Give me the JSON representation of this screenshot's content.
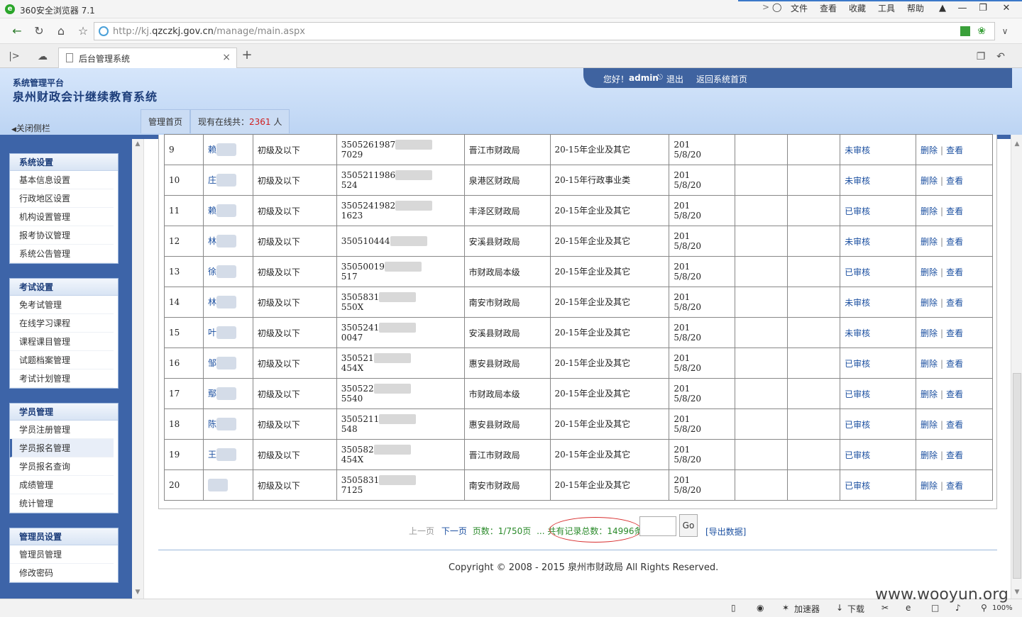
{
  "browser": {
    "title": "360安全浏览器 7.1",
    "menus": [
      "文件",
      "查看",
      "收藏",
      "工具",
      "帮助"
    ],
    "url_prefix": "http://kj.",
    "url_domain": "qzczkj.gov.cn",
    "url_path": "/manage/main.aspx",
    "tab_title": "后台管理系统",
    "tab_close": "×",
    "new_tab": "+"
  },
  "app": {
    "subtitle": "系统管理平台",
    "title": "泉州财政会计继续教育系统",
    "welcome": "您好！",
    "user": "admin",
    "logout": "退出",
    "home_return": "返回系统首页",
    "close_sidebar": "关闭侧栏",
    "tab_home": "管理首页",
    "online_prefix": "现有在线共：",
    "online_count": "2361",
    "online_suffix": "人"
  },
  "sidebar": [
    {
      "header": "系统设置",
      "items": [
        "基本信息设置",
        "行政地区设置",
        "机构设置管理",
        "报考协议管理",
        "系统公告管理"
      ]
    },
    {
      "header": "考试设置",
      "items": [
        "免考试管理",
        "在线学习课程",
        "课程课目管理",
        "试题档案管理",
        "考试计划管理"
      ]
    },
    {
      "header": "学员管理",
      "items": [
        "学员注册管理",
        "学员报名管理",
        "学员报名查询",
        "成绩管理",
        "统计管理"
      ]
    },
    {
      "header": "管理员设置",
      "items": [
        "管理员管理",
        "修改密码"
      ]
    }
  ],
  "table": {
    "rows": [
      {
        "no": "9",
        "name": "赖",
        "title": "初级及以下",
        "id1": "3505261987",
        "id2": "7029",
        "bureau": "晋江市财政局",
        "category": "20-15年企业及其它",
        "date1": "201",
        "date2": "5/8/20",
        "status": "未审核"
      },
      {
        "no": "10",
        "name": "庄",
        "title": "初级及以下",
        "id1": "3505211986",
        "id2": "524",
        "bureau": "泉港区财政局",
        "category": "20-15年行政事业类",
        "date1": "201",
        "date2": "5/8/20",
        "status": "未审核"
      },
      {
        "no": "11",
        "name": "赖",
        "title": "初级及以下",
        "id1": "3505241982",
        "id2": "1623",
        "bureau": "丰泽区财政局",
        "category": "20-15年企业及其它",
        "date1": "201",
        "date2": "5/8/20",
        "status": "已审核"
      },
      {
        "no": "12",
        "name": "林",
        "title": "初级及以下",
        "id1": "350510444",
        "id2": "",
        "bureau": "安溪县财政局",
        "category": "20-15年企业及其它",
        "date1": "201",
        "date2": "5/8/20",
        "status": "未审核"
      },
      {
        "no": "13",
        "name": "徐",
        "title": "初级及以下",
        "id1": "35050019",
        "id2": "517",
        "bureau": "市财政局本级",
        "category": "20-15年企业及其它",
        "date1": "201",
        "date2": "5/8/20",
        "status": "已审核"
      },
      {
        "no": "14",
        "name": "林",
        "title": "初级及以下",
        "id1": "3505831",
        "id2": "550X",
        "bureau": "南安市财政局",
        "category": "20-15年企业及其它",
        "date1": "201",
        "date2": "5/8/20",
        "status": "未审核"
      },
      {
        "no": "15",
        "name": "叶",
        "title": "初级及以下",
        "id1": "3505241",
        "id2": "0047",
        "bureau": "安溪县财政局",
        "category": "20-15年企业及其它",
        "date1": "201",
        "date2": "5/8/20",
        "status": "未审核"
      },
      {
        "no": "16",
        "name": "邹",
        "title": "初级及以下",
        "id1": "350521",
        "id2": "454X",
        "bureau": "惠安县财政局",
        "category": "20-15年企业及其它",
        "date1": "201",
        "date2": "5/8/20",
        "status": "已审核"
      },
      {
        "no": "17",
        "name": "鄢",
        "title": "初级及以下",
        "id1": "350522",
        "id2": "5540",
        "bureau": "市财政局本级",
        "category": "20-15年企业及其它",
        "date1": "201",
        "date2": "5/8/20",
        "status": "已审核"
      },
      {
        "no": "18",
        "name": "陈",
        "title": "初级及以下",
        "id1": "3505211",
        "id2": "548",
        "bureau": "惠安县财政局",
        "category": "20-15年企业及其它",
        "date1": "201",
        "date2": "5/8/20",
        "status": "已审核"
      },
      {
        "no": "19",
        "name": "王",
        "title": "初级及以下",
        "id1": "350582",
        "id2": "454X",
        "bureau": "晋江市财政局",
        "category": "20-15年企业及其它",
        "date1": "201",
        "date2": "5/8/20",
        "status": "已审核"
      },
      {
        "no": "20",
        "name": "",
        "title": "初级及以下",
        "id1": "3505831",
        "id2": "7125",
        "bureau": "南安市财政局",
        "category": "20-15年企业及其它",
        "date1": "201",
        "date2": "5/8/20",
        "status": "已审核"
      }
    ],
    "action_delete": "删除",
    "action_separator": "|",
    "action_view": "查看"
  },
  "pager": {
    "prev": "上一页",
    "next": "下一页",
    "pages": "页数：1/750页",
    "total": "... 共有记录总数：14996条",
    "go": "Go",
    "export": "[导出数据]"
  },
  "footer": {
    "copyright": "Copyright © 2008 - 2015 泉州市财政局 All Rights Reserved."
  },
  "statusbar": {
    "accelerator": "加速器",
    "download": "下载",
    "zoom": "100%"
  },
  "watermark": "www.wooyun.org",
  "colors": {
    "header_dark": "#3d64a8",
    "header_light": "#bcd4f3",
    "link": "#1b4fa0",
    "online_count": "#d02020",
    "highlight_ellipse": "#d83030"
  }
}
